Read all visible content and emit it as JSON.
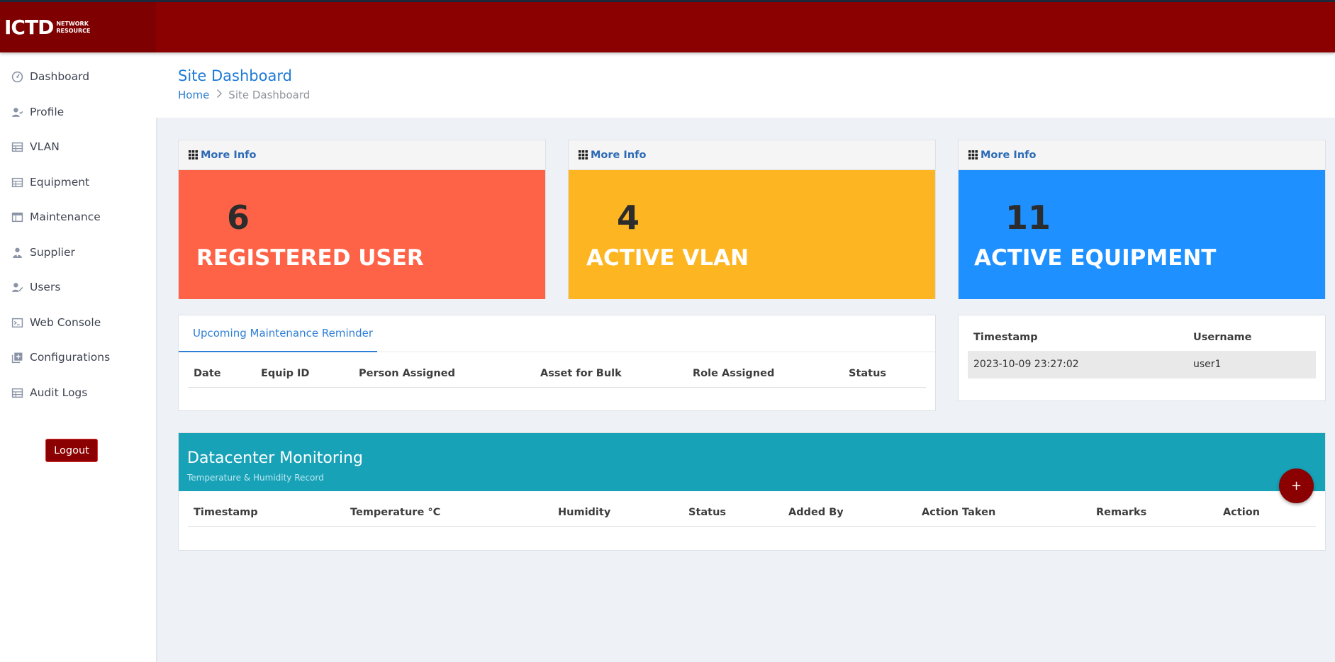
{
  "brand": {
    "main": "ICTD",
    "sub_line1": "NETWORK",
    "sub_line2": "RESOURCE"
  },
  "sidebar": {
    "items": [
      {
        "label": "Dashboard",
        "icon": "dashboard-icon"
      },
      {
        "label": "Profile",
        "icon": "user-check-icon"
      },
      {
        "label": "VLAN",
        "icon": "table-icon"
      },
      {
        "label": "Equipment",
        "icon": "table-icon"
      },
      {
        "label": "Maintenance",
        "icon": "layout-icon"
      },
      {
        "label": "Supplier",
        "icon": "user-tie-icon"
      },
      {
        "label": "Users",
        "icon": "user-edit-icon"
      },
      {
        "label": "Web Console",
        "icon": "terminal-icon"
      },
      {
        "label": "Configurations",
        "icon": "plus-square-icon"
      },
      {
        "label": "Audit Logs",
        "icon": "table-icon"
      }
    ],
    "logout_label": "Logout"
  },
  "header": {
    "title": "Site Dashboard",
    "breadcrumb": {
      "home": "Home",
      "current": "Site Dashboard"
    }
  },
  "cards": [
    {
      "more_info": "More Info",
      "value": "6",
      "label": "REGISTERED USER",
      "color": "#ff6347"
    },
    {
      "more_info": "More Info",
      "value": "4",
      "label": "ACTIVE VLAN",
      "color": "#fdb622"
    },
    {
      "more_info": "More Info",
      "value": "11",
      "label": "ACTIVE EQUIPMENT",
      "color": "#1e90ff"
    }
  ],
  "maintenance": {
    "tab_label": "Upcoming Maintenance Reminder",
    "columns": [
      "Date",
      "Equip ID",
      "Person Assigned",
      "Asset for Bulk",
      "Role Assigned",
      "Status"
    ]
  },
  "login_log": {
    "columns": [
      "Timestamp",
      "Username"
    ],
    "rows": [
      {
        "timestamp": "2023-10-09 23:27:02",
        "username": "user1"
      }
    ]
  },
  "datacenter": {
    "title": "Datacenter Monitoring",
    "subtitle": "Temperature & Humidity Record",
    "add_label": "+",
    "columns": [
      "Timestamp",
      "Temperature °C",
      "Humidity",
      "Status",
      "Added By",
      "Action Taken",
      "Remarks",
      "Action"
    ]
  },
  "colors": {
    "topbar": "#8b0000",
    "accent": "#1e7ad6",
    "teal": "#17a2b8"
  }
}
